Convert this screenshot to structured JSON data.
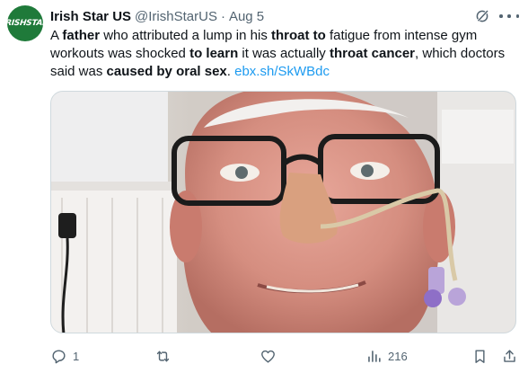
{
  "tweet": {
    "author": {
      "avatar_text": "IRISHSTAR",
      "display_name": "Irish Star US",
      "handle": "@IrishStarUS",
      "separator": "·",
      "date": "Aug 5"
    },
    "text": {
      "s1": "A ",
      "b1": "father",
      "s2": " who attributed a lump in his ",
      "b2": "throat to",
      "s3": " fatigue from intense gym workouts was shocked ",
      "b3": "to learn",
      "s4": " it was actually ",
      "b4": "throat cancer",
      "s5": ", which doctors said was ",
      "b5": "caused by oral sex",
      "s6": ". ",
      "link": "ebx.sh/SkWBdc"
    },
    "actions": {
      "replies": "1",
      "reposts": "",
      "likes": "",
      "views": "216"
    },
    "colors": {
      "accent": "#1d9bf0",
      "avatar_bg": "#1f7a3a",
      "muted": "#536471"
    }
  }
}
